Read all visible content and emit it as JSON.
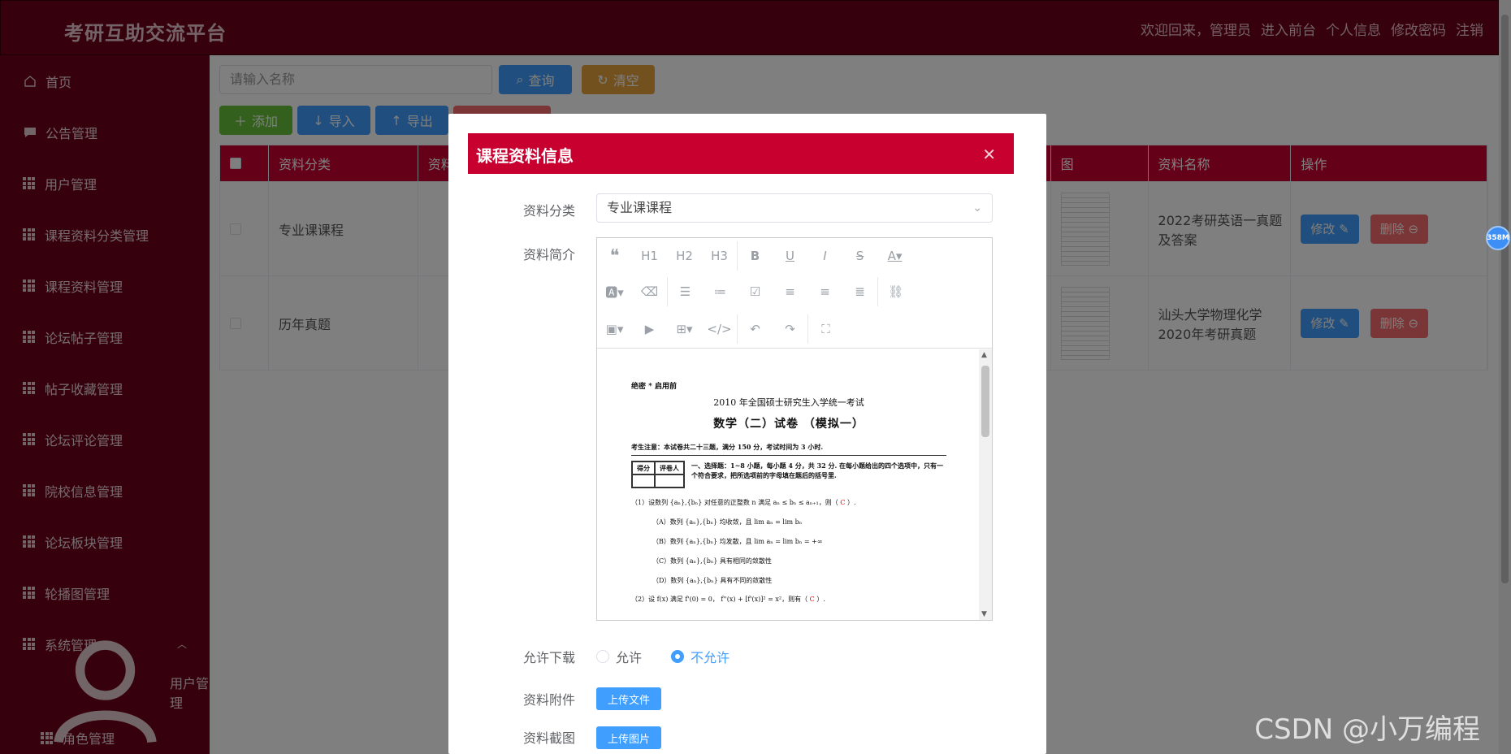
{
  "app": {
    "title": "考研互助交流平台",
    "top_links": [
      "欢迎回来，管理员",
      "进入前台",
      "个人信息",
      "修改密码",
      "注销"
    ]
  },
  "sidebar": {
    "items": [
      {
        "label": "首页",
        "icon": "home-icon"
      },
      {
        "label": "公告管理",
        "icon": "message-icon"
      },
      {
        "label": "用户管理",
        "icon": "grid-icon"
      },
      {
        "label": "课程资料分类管理",
        "icon": "grid-icon"
      },
      {
        "label": "课程资料管理",
        "icon": "grid-icon"
      },
      {
        "label": "论坛帖子管理",
        "icon": "grid-icon"
      },
      {
        "label": "帖子收藏管理",
        "icon": "grid-icon"
      },
      {
        "label": "论坛评论管理",
        "icon": "grid-icon"
      },
      {
        "label": "院校信息管理",
        "icon": "grid-icon"
      },
      {
        "label": "论坛板块管理",
        "icon": "grid-icon"
      },
      {
        "label": "轮播图管理",
        "icon": "grid-icon"
      }
    ],
    "group": {
      "label": "系统管理",
      "icon": "grid-icon"
    },
    "sub_items": [
      {
        "label": "用户管理",
        "icon": "user-icon"
      },
      {
        "label": "角色管理",
        "icon": "grid-icon"
      }
    ]
  },
  "main": {
    "search_placeholder": "请输入名称",
    "query_label": "查询",
    "clear_label": "清空",
    "add_label": "添加",
    "import_label": "导入",
    "export_label": "导出",
    "table": {
      "headers": [
        "资料分类",
        "资料",
        "图",
        "资料名称",
        "操作"
      ],
      "rows": [
        {
          "category": "专业课课程",
          "name": "2022考研英语一真题及答案"
        },
        {
          "category": "历年真题",
          "name": "汕头大学物理化学2020年考研真题"
        }
      ],
      "edit_label": "修改",
      "delete_label": "删除"
    }
  },
  "dialog": {
    "title": "课程资料信息",
    "category_label": "资料分类",
    "category_value": "专业课课程",
    "intro_label": "资料简介",
    "toolbar": {
      "h1": "H1",
      "h2": "H2",
      "h3": "H3"
    },
    "doc": {
      "secret": "绝密 * 启用前",
      "title1": "2010 年全国硕士研究生入学统一考试",
      "title2": "数学（二）试卷 （模拟一）",
      "note": "考生注意：本试卷共二十三题，满分 150 分，考试时间为 3 小时.",
      "score_headers": [
        "得分",
        "评卷人"
      ],
      "section": "一、选择题：1~8 小题，每小题 4 分，共 32 分. 在每小题给出的四个选项中，只有一个符合要求，把所选项前的字母填在题后的括号里.",
      "q1": "（1）设数列 {aₙ},{bₙ} 对任意的正整数 n 满足 aₙ ≤ bₙ ≤ aₙ₊₁，则（",
      "q1_answer": "C",
      "q1_close": "）.",
      "options": [
        "（A）数列 {aₙ},{bₙ} 均收敛，且 lim aₙ = lim bₙ",
        "（B）数列 {aₙ},{bₙ} 均发散，且 lim aₙ = lim bₙ = +∞",
        "（C）数列 {aₙ},{bₙ} 具有相同的敛散性",
        "（D）数列 {aₙ},{bₙ} 具有不同的敛散性"
      ],
      "q2": "（2）设 f(x) 满足 f'(0) = 0，  f''(x) + [f'(x)]² = x²，则有（",
      "q2_answer": "C",
      "q2_close": "）."
    },
    "download_label": "允许下载",
    "allow_label": "允许",
    "disallow_label": "不允许",
    "attachment_label": "资料附件",
    "upload_file_label": "上传文件",
    "screenshot_label": "资料截图",
    "upload_image_label": "上传图片"
  },
  "badge": "358M",
  "watermark": "CSDN @小万编程"
}
